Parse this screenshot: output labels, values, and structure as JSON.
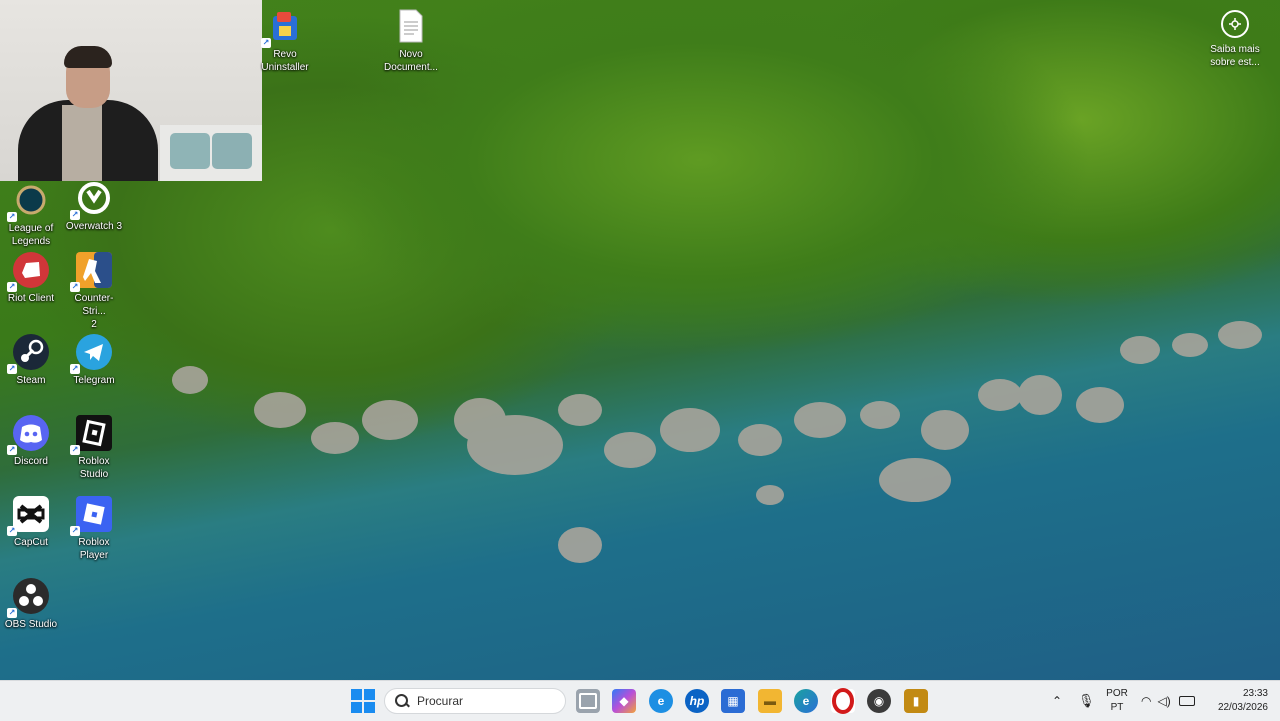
{
  "desktop": {
    "top_icons": [
      {
        "id": "revo",
        "label": "Revo\nUninstaller",
        "icon": "revo-uninstaller-icon"
      },
      {
        "id": "novo",
        "label": "Novo\nDocument...",
        "icon": "text-document-icon"
      }
    ],
    "left_icons": [
      {
        "id": "lol",
        "label": "League of\nLegends",
        "icon": "league-of-legends-icon"
      },
      {
        "id": "ow",
        "label": "Overwatch 3",
        "icon": "overwatch-icon"
      },
      {
        "id": "riot",
        "label": "Riot Client",
        "icon": "riot-client-icon"
      },
      {
        "id": "cs",
        "label": "Counter-Stri...\n2",
        "icon": "counter-strike-icon"
      },
      {
        "id": "steam",
        "label": "Steam",
        "icon": "steam-icon"
      },
      {
        "id": "telegram",
        "label": "Telegram",
        "icon": "telegram-icon"
      },
      {
        "id": "discord",
        "label": "Discord",
        "icon": "discord-icon"
      },
      {
        "id": "roblox_studio",
        "label": "Roblox\nStudio",
        "icon": "roblox-studio-icon"
      },
      {
        "id": "capcut",
        "label": "CapCut",
        "icon": "capcut-icon"
      },
      {
        "id": "roblox_player",
        "label": "Roblox Player",
        "icon": "roblox-player-icon"
      },
      {
        "id": "obs",
        "label": "OBS Studio",
        "icon": "obs-studio-icon"
      }
    ],
    "learn_more": {
      "label": "Saiba mais\nsobre est...",
      "icon": "spotlight-camera-icon"
    }
  },
  "taskbar": {
    "search_placeholder": "Procurar",
    "pinned": [
      {
        "name": "task-view",
        "icon": "task-view-icon",
        "color": "#6b7280"
      },
      {
        "name": "copilot",
        "icon": "copilot-icon",
        "color": "#8a5cf6"
      },
      {
        "name": "edge-dev",
        "icon": "edge-icon",
        "color": "#1d8fe3"
      },
      {
        "name": "hp",
        "icon": "hp-icon",
        "color": "#0b63c5"
      },
      {
        "name": "store",
        "icon": "microsoft-store-icon",
        "color": "#2b6cd4"
      },
      {
        "name": "explorer",
        "icon": "file-explorer-icon",
        "color": "#f2b632"
      },
      {
        "name": "edge",
        "icon": "edge-icon",
        "color": "#1aa2a0"
      },
      {
        "name": "opera",
        "icon": "opera-icon",
        "color": "#d21a1a"
      },
      {
        "name": "steam-tb",
        "icon": "steam-icon",
        "color": "#3b3b3b"
      },
      {
        "name": "revo-tb",
        "icon": "revo-uninstaller-icon",
        "color": "#c28a13"
      }
    ],
    "tray": {
      "lang_line1": "POR",
      "lang_line2": "PT",
      "time": "23:33",
      "date": "22/03/2026"
    }
  }
}
